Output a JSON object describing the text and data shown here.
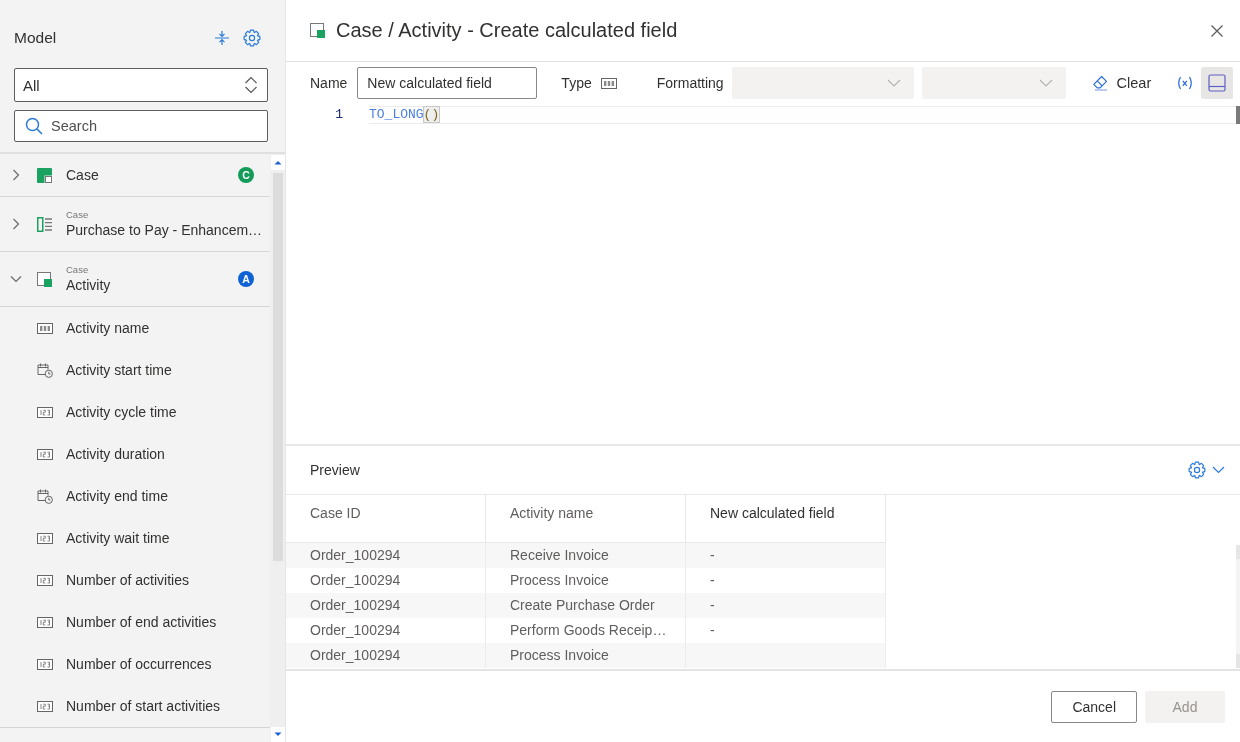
{
  "sidebar": {
    "title": "Model",
    "filter": {
      "value": "All"
    },
    "search": {
      "placeholder": "Search"
    },
    "tree": [
      {
        "kind": "case-table",
        "label": "Case",
        "expanded": false,
        "badge": {
          "text": "C",
          "color": "#139b58"
        }
      },
      {
        "kind": "enhancement-table",
        "context": "Case",
        "label": "Purchase to Pay - Enhancem…",
        "expanded": false
      },
      {
        "kind": "activity-table",
        "context": "Case",
        "label": "Activity",
        "expanded": true,
        "badge": {
          "text": "A",
          "color": "#0f62d6"
        },
        "children": [
          {
            "kind": "text",
            "label": "Activity name"
          },
          {
            "kind": "datetime",
            "label": "Activity start time"
          },
          {
            "kind": "number",
            "label": "Activity cycle time"
          },
          {
            "kind": "number",
            "label": "Activity duration"
          },
          {
            "kind": "datetime",
            "label": "Activity end time"
          },
          {
            "kind": "number",
            "label": "Activity wait time"
          },
          {
            "kind": "number",
            "label": "Number of activities"
          },
          {
            "kind": "number",
            "label": "Number of end activities"
          },
          {
            "kind": "number",
            "label": "Number of occurrences"
          },
          {
            "kind": "number",
            "label": "Number of start activities"
          }
        ]
      }
    ]
  },
  "dialog": {
    "title": "Case / Activity - Create calculated field",
    "toolbar": {
      "name": {
        "label": "Name",
        "value": "New calculated field"
      },
      "type": {
        "label": "Type"
      },
      "formatting": {
        "label": "Formatting",
        "selects": [
          {
            "disabled": true
          },
          {
            "disabled": true
          }
        ]
      },
      "clear": {
        "label": "Clear"
      },
      "panel_toggle": {
        "selected": true
      }
    },
    "editor": {
      "lines": [
        {
          "number": "1",
          "current": true,
          "tokens": [
            {
              "kind": "function",
              "text": "TO_LONG"
            },
            {
              "kind": "matched-bracket",
              "text": "()"
            }
          ]
        }
      ]
    },
    "preview": {
      "title": "Preview",
      "table": {
        "columns": [
          {
            "label": "Case ID",
            "kind": "source"
          },
          {
            "label": "Activity name",
            "kind": "source"
          },
          {
            "label": "New calculated field",
            "kind": "calculated"
          }
        ],
        "rows": [
          [
            "Order_100294",
            "Receive Invoice",
            "-"
          ],
          [
            "Order_100294",
            "Process Invoice",
            "-"
          ],
          [
            "Order_100294",
            "Create Purchase Order",
            "-"
          ],
          [
            "Order_100294",
            "Perform Goods Receip…",
            "-"
          ],
          [
            "Order_100294",
            "Process Invoice"
          ]
        ]
      }
    },
    "footer": {
      "buttons": [
        {
          "label": "Cancel",
          "kind": "secondary",
          "disabled": false
        },
        {
          "label": "Add",
          "kind": "primary",
          "disabled": true
        }
      ]
    }
  }
}
